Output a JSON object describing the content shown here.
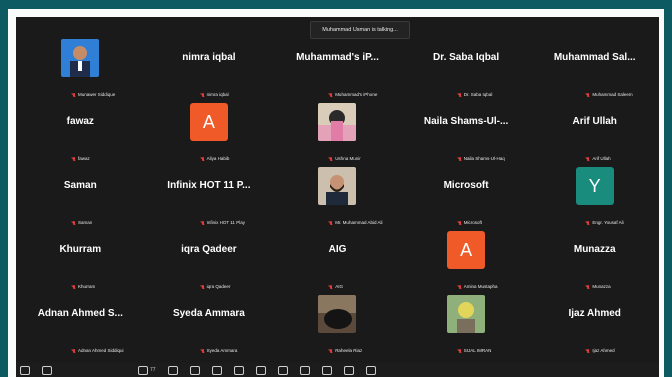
{
  "speaker_banner": "Muhammad Usman is talking...",
  "tiles": [
    {
      "kind": "photo",
      "photo": "man-blue",
      "name": "Munawer Siddique"
    },
    {
      "kind": "name",
      "display": "nimra iqbal",
      "name": "nimra iqbal"
    },
    {
      "kind": "name",
      "display": "Muhammad's iP...",
      "name": "Muhammad's iPhone"
    },
    {
      "kind": "name",
      "display": "Dr. Saba Iqbal",
      "name": "Dr. Saba Iqbal"
    },
    {
      "kind": "name",
      "display": "Muhammad Sal...",
      "name": "Muhammad Saleem"
    },
    {
      "kind": "name",
      "display": "fawaz",
      "name": "fawaz"
    },
    {
      "kind": "avatar",
      "letter": "A",
      "color": "#f05a28",
      "name": "Aliya Habib"
    },
    {
      "kind": "photo",
      "photo": "woman",
      "name": "Ushna Munir"
    },
    {
      "kind": "name",
      "display": "Naila Shams-Ul-...",
      "name": "Naila Shams-Ul-Haq"
    },
    {
      "kind": "name",
      "display": "Arif Ullah",
      "name": "Arif Ullah"
    },
    {
      "kind": "name",
      "display": "Saman",
      "name": "Saman"
    },
    {
      "kind": "name",
      "display": "Infinix HOT 11 P...",
      "name": "Infinix HOT 11 Play"
    },
    {
      "kind": "photo",
      "photo": "man-beard",
      "name": "Mr. Muhammad Abid Ali"
    },
    {
      "kind": "name",
      "display": "Microsoft",
      "name": "Microsoft"
    },
    {
      "kind": "avatar",
      "letter": "Y",
      "color": "#1a8c7e",
      "name": "Engr. Yousaf Ali"
    },
    {
      "kind": "name",
      "display": "Khurram",
      "name": "Khurram"
    },
    {
      "kind": "name",
      "display": "iqra Qadeer",
      "name": "iqra Qadeer"
    },
    {
      "kind": "name",
      "display": "AIG",
      "name": "AIG"
    },
    {
      "kind": "avatar",
      "letter": "A",
      "color": "#f05a28",
      "name": "Amina Mustapha"
    },
    {
      "kind": "name",
      "display": "Munazza",
      "name": "Munazza"
    },
    {
      "kind": "name",
      "display": "Adnan Ahmed S...",
      "name": "Adnan Ahmed Siddiqui"
    },
    {
      "kind": "name",
      "display": "Syeda Ammara",
      "name": "Syeda Ammara"
    },
    {
      "kind": "photo",
      "photo": "dark",
      "name": "Raheela Riaz"
    },
    {
      "kind": "photo",
      "photo": "nature",
      "name": "SIJAL IMRAN"
    },
    {
      "kind": "name",
      "display": "Ijaz Ahmed",
      "name": "Ijaz Ahmed"
    }
  ],
  "toolbar": {
    "participants_count": "77"
  }
}
